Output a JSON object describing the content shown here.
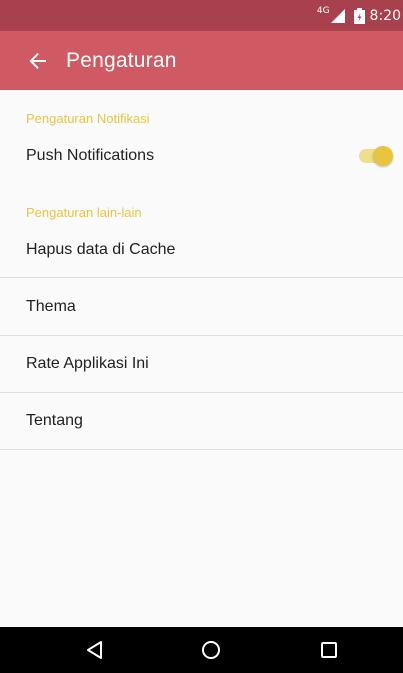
{
  "status_bar": {
    "network_label": "4G",
    "time": "8:20",
    "signal_icon": "signal-icon",
    "battery_icon": "battery-icon"
  },
  "toolbar": {
    "back_icon": "arrow-back-icon",
    "title": "Pengaturan"
  },
  "sections": {
    "notifications": {
      "header": "Pengaturan Notifikasi",
      "push_label": "Push Notifications",
      "push_enabled": true
    },
    "other": {
      "header": "Pengaturan lain-lain",
      "items": [
        {
          "label": "Hapus data di Cache"
        },
        {
          "label": "Thema"
        },
        {
          "label": "Rate Applikasi Ini"
        },
        {
          "label": "Tentang"
        }
      ]
    }
  },
  "nav_bar": {
    "back_icon": "triangle-back-icon",
    "home_icon": "circle-home-icon",
    "recent_icon": "square-recents-icon"
  },
  "colors": {
    "status_bar": "#a8414d",
    "toolbar": "#cf5a63",
    "accent": "#e8c541",
    "switch_track": "#f2dd8b",
    "divider": "#dedede",
    "text": "#212121"
  }
}
